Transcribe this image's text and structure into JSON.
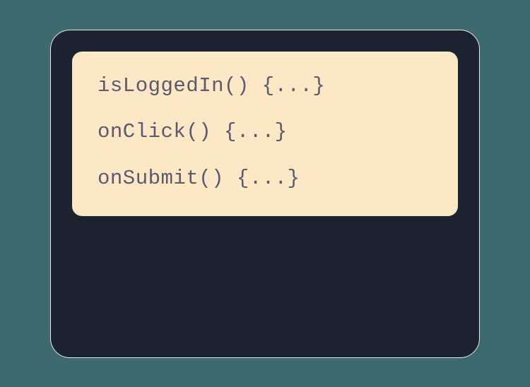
{
  "code": {
    "lines": [
      "isLoggedIn() {...}",
      "onClick() {...}",
      "onSubmit() {...}"
    ]
  }
}
